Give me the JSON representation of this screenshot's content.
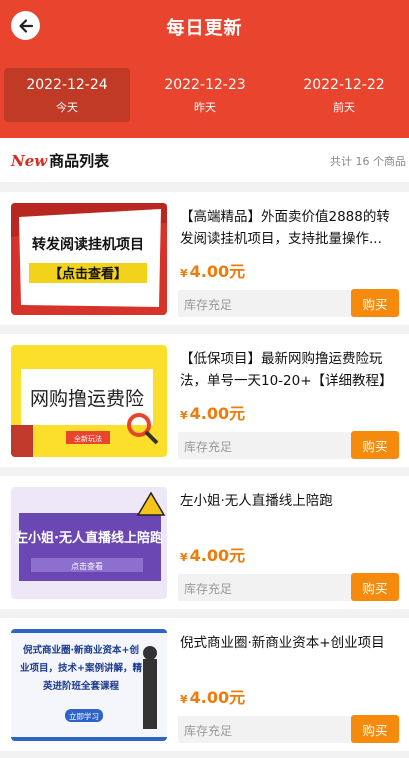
{
  "header": {
    "title": "每日更新",
    "dates": [
      {
        "date": "2022-12-24",
        "label": "今天"
      },
      {
        "date": "2022-12-23",
        "label": "昨天"
      },
      {
        "date": "2022-12-22",
        "label": "前天"
      }
    ]
  },
  "list": {
    "new_tag": "New",
    "title": "商品列表",
    "count": "共计 16 个商品"
  },
  "products": [
    {
      "title": "【高端精品】外面卖价值2888的转发阅读挂机项目，支持批量操作...",
      "currency": "¥",
      "price": "4.00元",
      "stock": "库存充足",
      "buy": "购买",
      "thumb_lines": [
        "转发阅读挂机项目",
        "【点击查看】"
      ]
    },
    {
      "title": "【低保项目】最新网购撸运费险玩法，单号一天10-20+【详细教程】",
      "currency": "¥",
      "price": "4.00元",
      "stock": "库存充足",
      "buy": "购买",
      "thumb_lines": [
        "网购撸运费险",
        "全新玩法"
      ]
    },
    {
      "title": "左小姐·无人直播线上陪跑",
      "currency": "¥",
      "price": "4.00元",
      "stock": "库存充足",
      "buy": "购买",
      "thumb_lines": [
        "左小姐·无人直播线上陪跑",
        "点击查看"
      ]
    },
    {
      "title": "倪式商业圈·新商业资本+创业项目",
      "currency": "¥",
      "price": "4.00元",
      "stock": "库存充足",
      "buy": "购买",
      "thumb_lines": [
        "倪式商业圈·新商业资本+创",
        "业项目，技术+案例讲解，精",
        "英进阶班全套课程",
        "立即学习"
      ]
    }
  ],
  "colors": {
    "header": "#e8442e",
    "active_tab": "#c03a25",
    "price": "#ef7b0a",
    "buy_button": "#f68a0c"
  }
}
